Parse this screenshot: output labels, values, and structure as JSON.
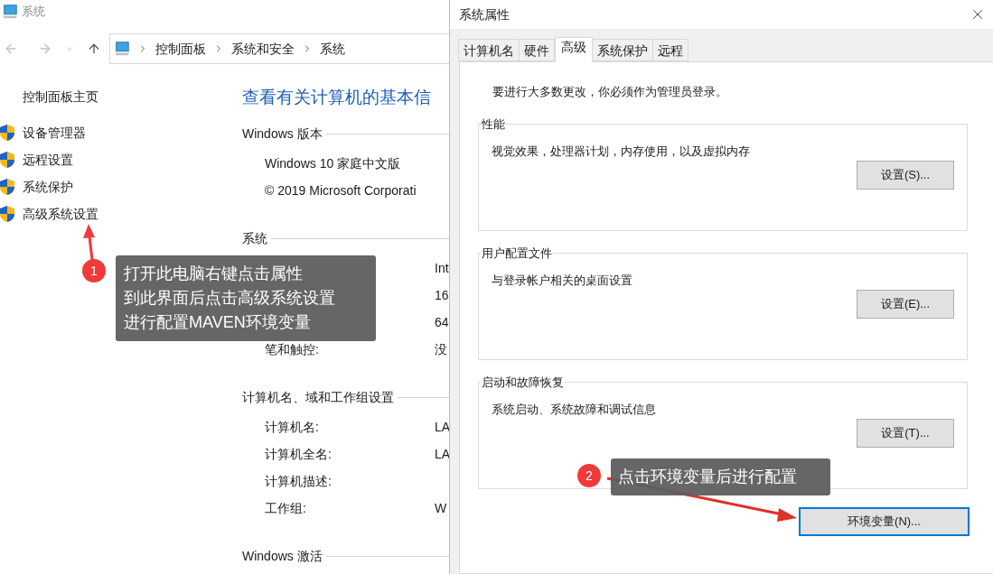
{
  "window": {
    "title": "系统"
  },
  "breadcrumb": [
    "控制面板",
    "系统和安全",
    "系统"
  ],
  "sidebar": {
    "home": "控制面板主页",
    "items": [
      "设备管理器",
      "远程设置",
      "系统保护",
      "高级系统设置"
    ]
  },
  "heading": "查看有关计算机的基本信",
  "sections": [
    {
      "title": "Windows 版本",
      "rows": [
        {
          "text": "Windows 10 家庭中文版"
        },
        {
          "text": "© 2019 Microsoft Corporati"
        }
      ]
    },
    {
      "title": "系统",
      "rows": [
        {
          "value": "Int"
        },
        {
          "value": "16"
        },
        {
          "value": "64"
        },
        {
          "label": "笔和触控:",
          "value": "没"
        }
      ]
    },
    {
      "title": "计算机名、域和工作组设置",
      "rows": [
        {
          "label": "计算机名:",
          "value": "LA"
        },
        {
          "label": "计算机全名:",
          "value": "LA"
        },
        {
          "label": "计算机描述:"
        },
        {
          "label": "工作组:",
          "value": "W"
        }
      ]
    },
    {
      "title": "Windows 激活"
    }
  ],
  "dialog": {
    "title": "系统属性",
    "tabs": [
      {
        "label": "计算机名",
        "selected": false
      },
      {
        "label": "硬件",
        "selected": false
      },
      {
        "label": "高级",
        "selected": true
      },
      {
        "label": "系统保护",
        "selected": false
      },
      {
        "label": "远程",
        "selected": false
      }
    ],
    "notice": "要进行大多数更改，你必须作为管理员登录。",
    "groups": [
      {
        "title": "性能",
        "description": "视觉效果，处理器计划，内存使用，以及虚拟内存",
        "button": "设置(S)..."
      },
      {
        "title": "用户配置文件",
        "description": "与登录帐户相关的桌面设置",
        "button": "设置(E)..."
      },
      {
        "title": "启动和故障恢复",
        "description": "系统启动、系统故障和调试信息",
        "button": "设置(T)..."
      }
    ],
    "env_button": "环境变量(N)..."
  },
  "callouts": [
    {
      "number": "1",
      "lines": [
        "打开此电脑右键点击属性",
        "到此界面后点击高级系统设置",
        "进行配置MAVEN环境变量"
      ]
    },
    {
      "number": "2",
      "lines": [
        "点击环境变量后进行配置"
      ]
    }
  ]
}
